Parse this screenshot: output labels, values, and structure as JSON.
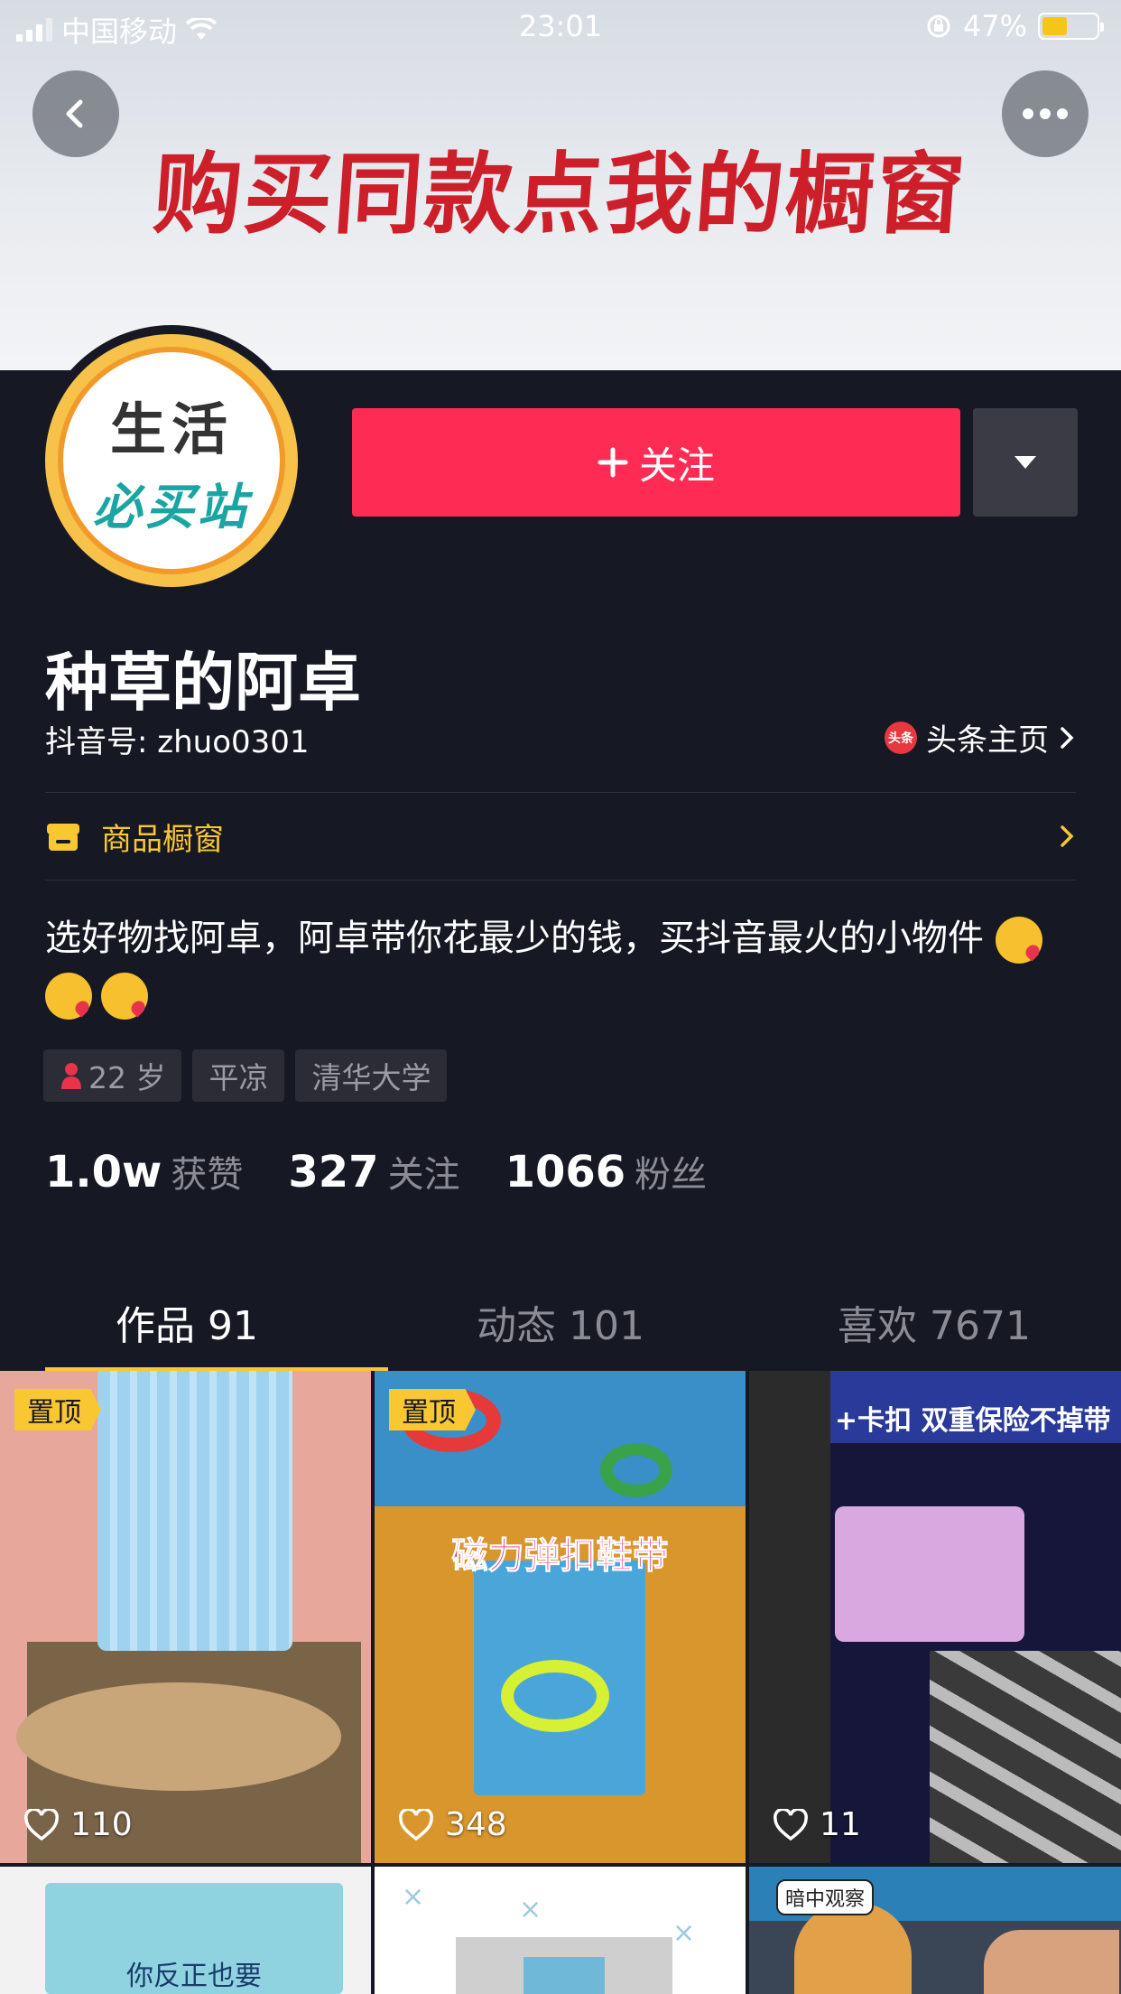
{
  "status_bar": {
    "carrier": "中国移动",
    "time": "23:01",
    "battery_pct": "47%",
    "battery_level": 0.47
  },
  "banner": {
    "text": "购买同款点我的橱窗"
  },
  "avatar": {
    "line1": "生活",
    "line2": "必买站"
  },
  "actions": {
    "follow_label": "关注"
  },
  "profile": {
    "nickname": "种草的阿卓",
    "douyin_id": "抖音号: zhuo0301",
    "toutiao_link": "头条主页",
    "toutiao_logo_text": "头条",
    "shop_label": "商品橱窗",
    "bio_line": "选好物找阿卓，阿卓带你花最少的钱，买抖音最火的小物件"
  },
  "tags": {
    "age": "22 岁",
    "city": "平凉",
    "school": "清华大学"
  },
  "stats": [
    {
      "num": "1.0w",
      "label": "获赞"
    },
    {
      "num": "327",
      "label": "关注"
    },
    {
      "num": "1066",
      "label": "粉丝"
    }
  ],
  "tabs": [
    {
      "label": "作品 91"
    },
    {
      "label": "动态 101"
    },
    {
      "label": "喜欢 7671"
    }
  ],
  "videos": [
    {
      "pinned": "置顶",
      "likes": "110"
    },
    {
      "pinned": "置顶",
      "likes": "348",
      "caption": "磁力弹扣鞋带"
    },
    {
      "likes": "11",
      "caption": "+卡扣 双重保险不掉带"
    },
    {
      "caption": "你反正也要"
    },
    {},
    {
      "caption": "暗中观察"
    }
  ],
  "colors": {
    "background": "#161823",
    "follow_button": "#fe2c55",
    "accent_yellow": "#f8c731"
  }
}
